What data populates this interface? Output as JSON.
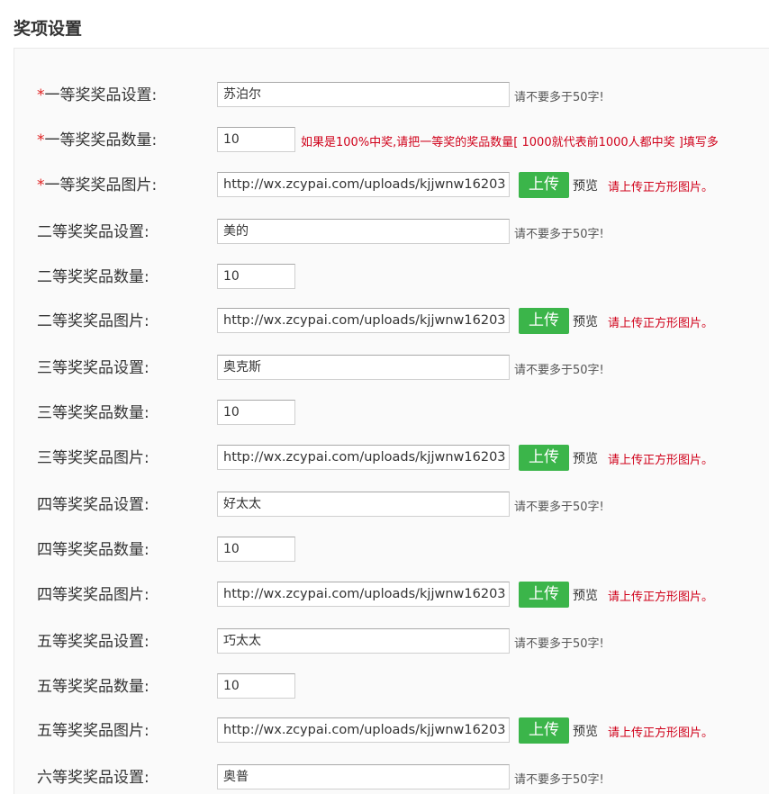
{
  "section_title": "奖项设置",
  "required_mark": "*",
  "hint_text": "请不要多于50字!",
  "upload_label": "上传",
  "preview_label": "预览",
  "image_hint": "请上传正方形图片。",
  "first_quantity_hint": "如果是100%中奖,请把一等奖的奖品数量[ 1000就代表前1000人都中奖 ]填写多",
  "prizes": [
    {
      "name_label": "一等奖奖品设置:",
      "name_value": "苏泊尔",
      "qty_label": "一等奖奖品数量:",
      "qty_value": "10",
      "img_label": "一等奖奖品图片:",
      "img_value": "http://wx.zcypai.com/uploads/kjjwnw16203"
    },
    {
      "name_label": "二等奖奖品设置:",
      "name_value": "美的",
      "qty_label": "二等奖奖品数量:",
      "qty_value": "10",
      "img_label": "二等奖奖品图片:",
      "img_value": "http://wx.zcypai.com/uploads/kjjwnw16203"
    },
    {
      "name_label": "三等奖奖品设置:",
      "name_value": "奥克斯",
      "qty_label": "三等奖奖品数量:",
      "qty_value": "10",
      "img_label": "三等奖奖品图片:",
      "img_value": "http://wx.zcypai.com/uploads/kjjwnw16203"
    },
    {
      "name_label": "四等奖奖品设置:",
      "name_value": "好太太",
      "qty_label": "四等奖奖品数量:",
      "qty_value": "10",
      "img_label": "四等奖奖品图片:",
      "img_value": "http://wx.zcypai.com/uploads/kjjwnw16203"
    },
    {
      "name_label": "五等奖奖品设置:",
      "name_value": "巧太太",
      "qty_label": "五等奖奖品数量:",
      "qty_value": "10",
      "img_label": "五等奖奖品图片:",
      "img_value": "http://wx.zcypai.com/uploads/kjjwnw16203"
    },
    {
      "name_label": "六等奖奖品设置:",
      "name_value": "奥普"
    }
  ]
}
